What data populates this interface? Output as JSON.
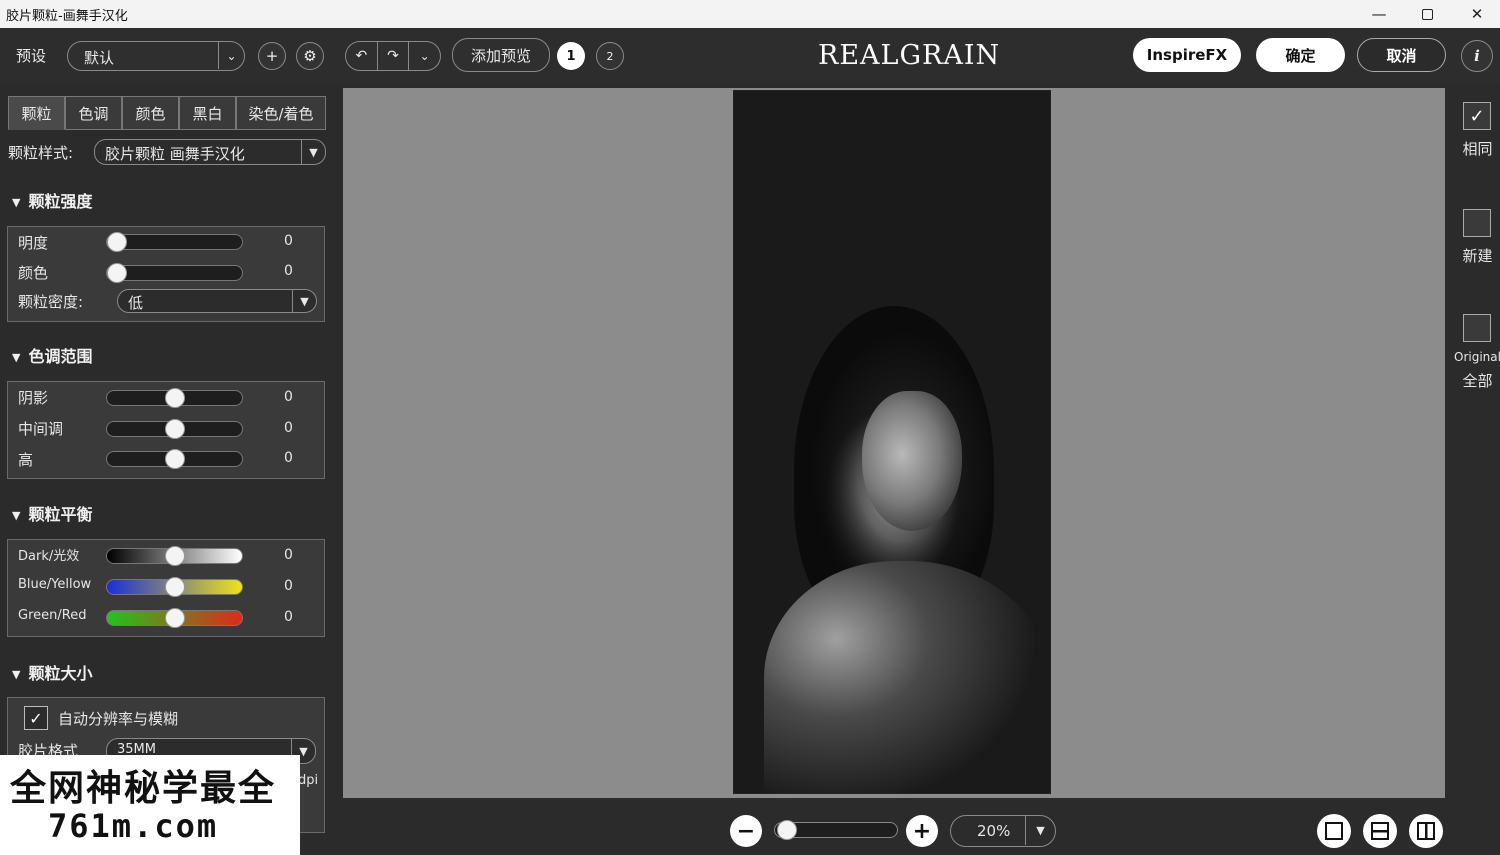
{
  "window": {
    "title": "胶片颗粒-画舞手汉化",
    "minimize_icon": "minimize-icon",
    "maximize_icon": "maximize-icon",
    "close_icon": "close-icon"
  },
  "toolbar": {
    "preset_label": "预设",
    "preset_value": "默认",
    "add_preset_icon": "plus-icon",
    "settings_icon": "gear-icon",
    "undo_icon": "undo-icon",
    "redo_icon": "redo-icon",
    "history_icon": "chevron-down-icon",
    "add_preview_label": "添加预览",
    "preview_1_label": "1",
    "preview_2_label": "2",
    "logo": "REALGRAIN",
    "inspirefx_label": "InspireFX",
    "ok_label": "确定",
    "cancel_label": "取消",
    "info_label": "i"
  },
  "tabs": [
    {
      "label": "颗粒",
      "active": true
    },
    {
      "label": "色调",
      "active": false
    },
    {
      "label": "颜色",
      "active": false
    },
    {
      "label": "黑白",
      "active": false
    },
    {
      "label": "染色/着色",
      "active": false
    }
  ],
  "grain_style": {
    "label": "颗粒样式:",
    "value": "胶片颗粒 画舞手汉化"
  },
  "grain_strength": {
    "title": "颗粒强度",
    "rows": [
      {
        "label": "明度",
        "value": "0",
        "level": 0.0
      },
      {
        "label": "颜色",
        "value": "0",
        "level": 0.0
      }
    ],
    "density_label": "颗粒密度:",
    "density_value": "低"
  },
  "tone_range": {
    "title": "色调范围",
    "rows": [
      {
        "label": "阴影",
        "value": "0",
        "level": 0.5
      },
      {
        "label": "中间调",
        "value": "0",
        "level": 0.5
      },
      {
        "label": "高",
        "value": "0",
        "level": 0.5
      }
    ]
  },
  "grain_balance": {
    "title": "颗粒平衡",
    "rows": [
      {
        "label": "Dark/光效",
        "value": "0",
        "level": 0.5,
        "gradient": [
          "#000000",
          "#ffffff"
        ]
      },
      {
        "label": "Blue/Yellow",
        "value": "0",
        "level": 0.5,
        "gradient": [
          "#1a2fd6",
          "#f1e21b"
        ]
      },
      {
        "label": "Green/Red",
        "value": "0",
        "level": 0.5,
        "gradient": [
          "#22c31f",
          "#e02a1c"
        ]
      }
    ]
  },
  "grain_size": {
    "title": "颗粒大小",
    "auto_label": "自动分辨率与模糊",
    "auto_checked": true,
    "film_format_label": "胶片格式",
    "film_format_value": "35MM",
    "dpi_label": "dpi"
  },
  "zoom": {
    "minus_label": "−",
    "plus_label": "+",
    "value": "20%",
    "level": 0.0
  },
  "right_panel": {
    "items": [
      {
        "label": "相同",
        "checked": true
      },
      {
        "label": "新建",
        "checked": false
      },
      {
        "label": "Original",
        "label2": "全部",
        "checked": false
      }
    ]
  },
  "watermark": {
    "line1": "全网神秘学最全",
    "line2": "761m.com"
  },
  "colors": {
    "panel": "#2b2b2b",
    "canvas": "#8c8c8c",
    "accent": "#ffffff"
  }
}
